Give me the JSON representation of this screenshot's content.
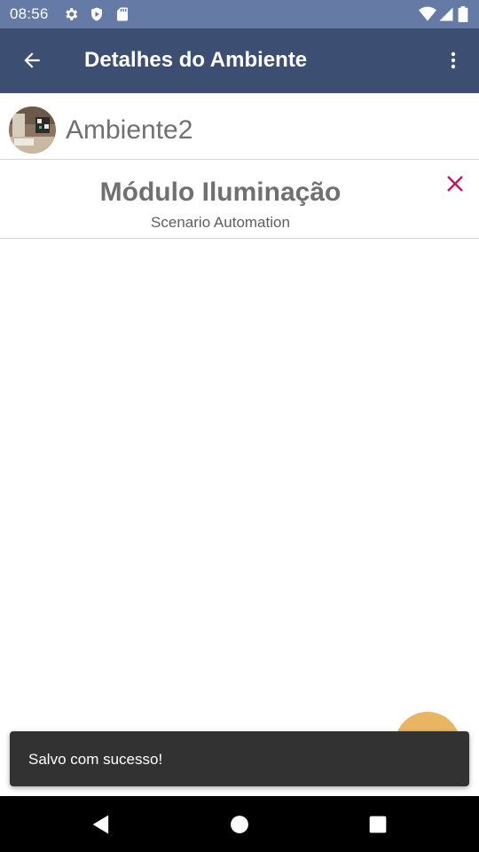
{
  "status_bar": {
    "time": "08:56",
    "left_icons": [
      "gear-icon",
      "play-protect-icon",
      "sd-card-icon"
    ],
    "right_icons": [
      "wifi-icon",
      "signal-icon",
      "battery-icon"
    ],
    "background": "#667aa6"
  },
  "app_bar": {
    "title": "Detalhes do Ambiente",
    "back_icon": "arrow-left-icon",
    "menu_icon": "more-vert-icon",
    "background": "#3c4f73"
  },
  "environment": {
    "name": "Ambiente2",
    "avatar": "room-photo-avatar"
  },
  "module": {
    "title": "Módulo Iluminação",
    "subtitle": "Scenario Automation",
    "close_icon": "close-icon",
    "close_color": "#c2185b"
  },
  "fab": {
    "color": "#e8b563"
  },
  "snackbar": {
    "message": "Salvo com sucesso!"
  },
  "nav_bar": {
    "buttons": [
      "back-triangle-icon",
      "home-circle-icon",
      "recents-square-icon"
    ]
  }
}
